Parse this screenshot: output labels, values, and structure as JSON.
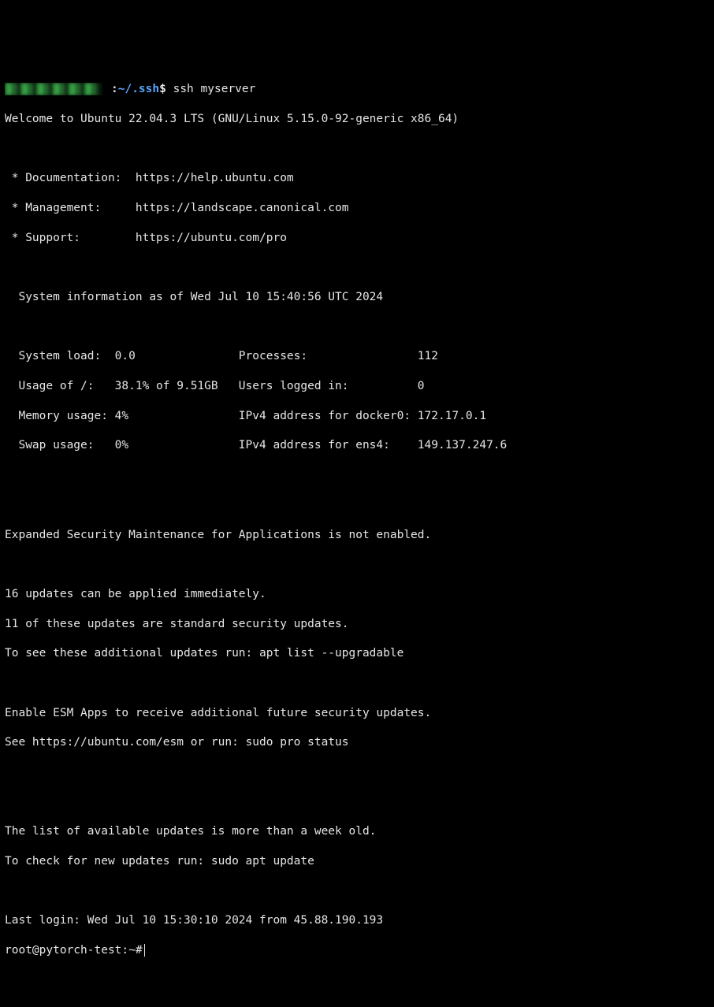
{
  "prompt1": {
    "colon": ":",
    "path": "~/.ssh",
    "dollar": "$",
    "command": " ssh myserver"
  },
  "welcome": "Welcome to Ubuntu 22.04.3 LTS (GNU/Linux 5.15.0-92-generic x86_64)",
  "bullets": {
    "doc": " * Documentation:  https://help.ubuntu.com",
    "mgmt": " * Management:     https://landscape.canonical.com",
    "support": " * Support:        https://ubuntu.com/pro"
  },
  "sysinfo_header": "  System information as of Wed Jul 10 15:40:56 UTC 2024",
  "stats": {
    "l1": "  System load:  0.0               Processes:                112",
    "l2": "  Usage of /:   38.1% of 9.51GB   Users logged in:          0",
    "l3": "  Memory usage: 4%                IPv4 address for docker0: 172.17.0.1",
    "l4": "  Swap usage:   0%                IPv4 address for ens4:    149.137.247.6"
  },
  "esm1": "Expanded Security Maintenance for Applications is not enabled.",
  "updates": {
    "l1": "16 updates can be applied immediately.",
    "l2": "11 of these updates are standard security updates.",
    "l3": "To see these additional updates run: apt list --upgradable"
  },
  "esm2": {
    "l1": "Enable ESM Apps to receive additional future security updates.",
    "l2": "See https://ubuntu.com/esm or run: sudo pro status"
  },
  "stale": {
    "l1": "The list of available updates is more than a week old.",
    "l2": "To check for new updates run: sudo apt update"
  },
  "lastlogin": "Last login: Wed Jul 10 15:30:10 2024 from 45.88.190.193",
  "prompt2": {
    "user_host": "root@pytorch-test",
    "colon": ":",
    "path": "~",
    "hash": "#"
  }
}
